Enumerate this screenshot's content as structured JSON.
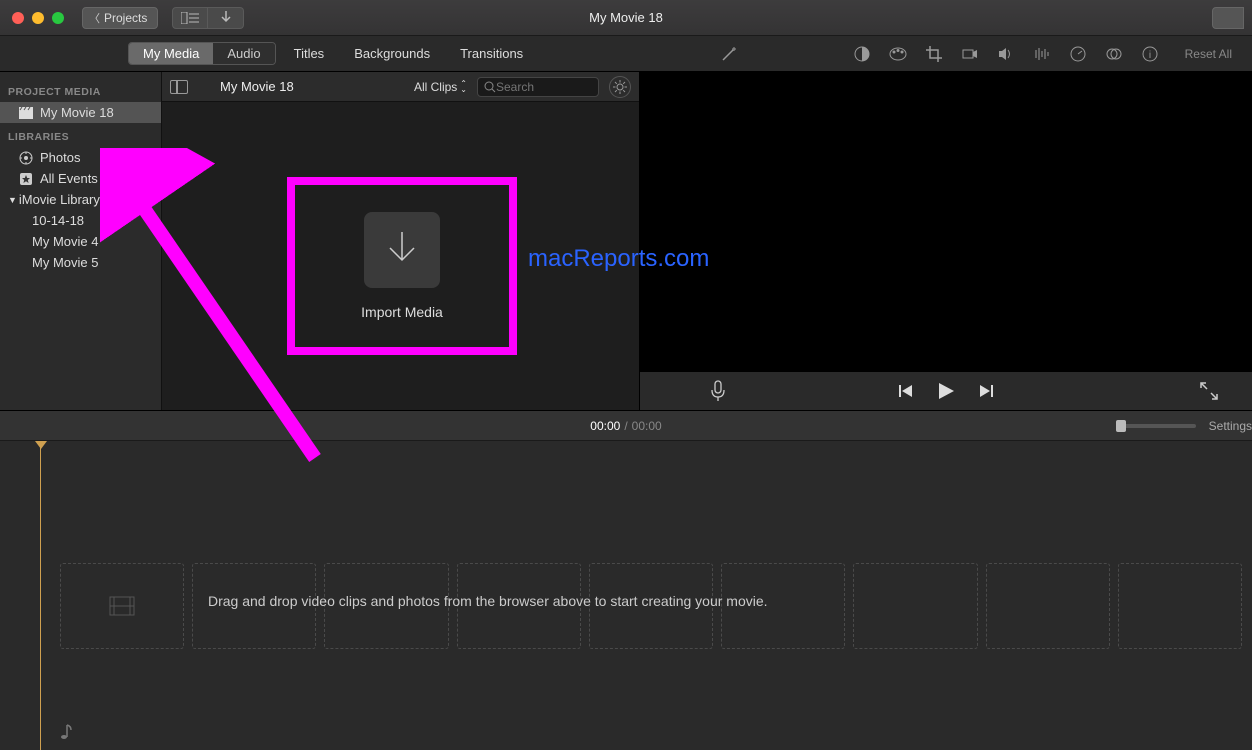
{
  "window": {
    "title": "My Movie 18"
  },
  "toolbar": {
    "back_label": "Projects"
  },
  "tabs": {
    "my_media": "My Media",
    "audio": "Audio",
    "titles": "Titles",
    "backgrounds": "Backgrounds",
    "transitions": "Transitions"
  },
  "sidebar": {
    "project_media_header": "PROJECT MEDIA",
    "project_name": "My Movie 18",
    "libraries_header": "LIBRARIES",
    "photos": "Photos",
    "all_events": "All Events",
    "imovie_library": "iMovie Library",
    "events": [
      "10-14-18",
      "My Movie 4",
      "My Movie 5"
    ]
  },
  "browser": {
    "project_name": "My Movie 18",
    "filter_label": "All Clips",
    "search_placeholder": "Search",
    "import_media_label": "Import Media"
  },
  "viewer": {
    "reset_all": "Reset All"
  },
  "timeline": {
    "current_time": "00:00",
    "total_time": "00:00",
    "settings_label": "Settings",
    "drop_hint": "Drag and drop video clips and photos from the browser above to start creating your movie."
  },
  "annotation": {
    "watermark": "macReports.com"
  }
}
